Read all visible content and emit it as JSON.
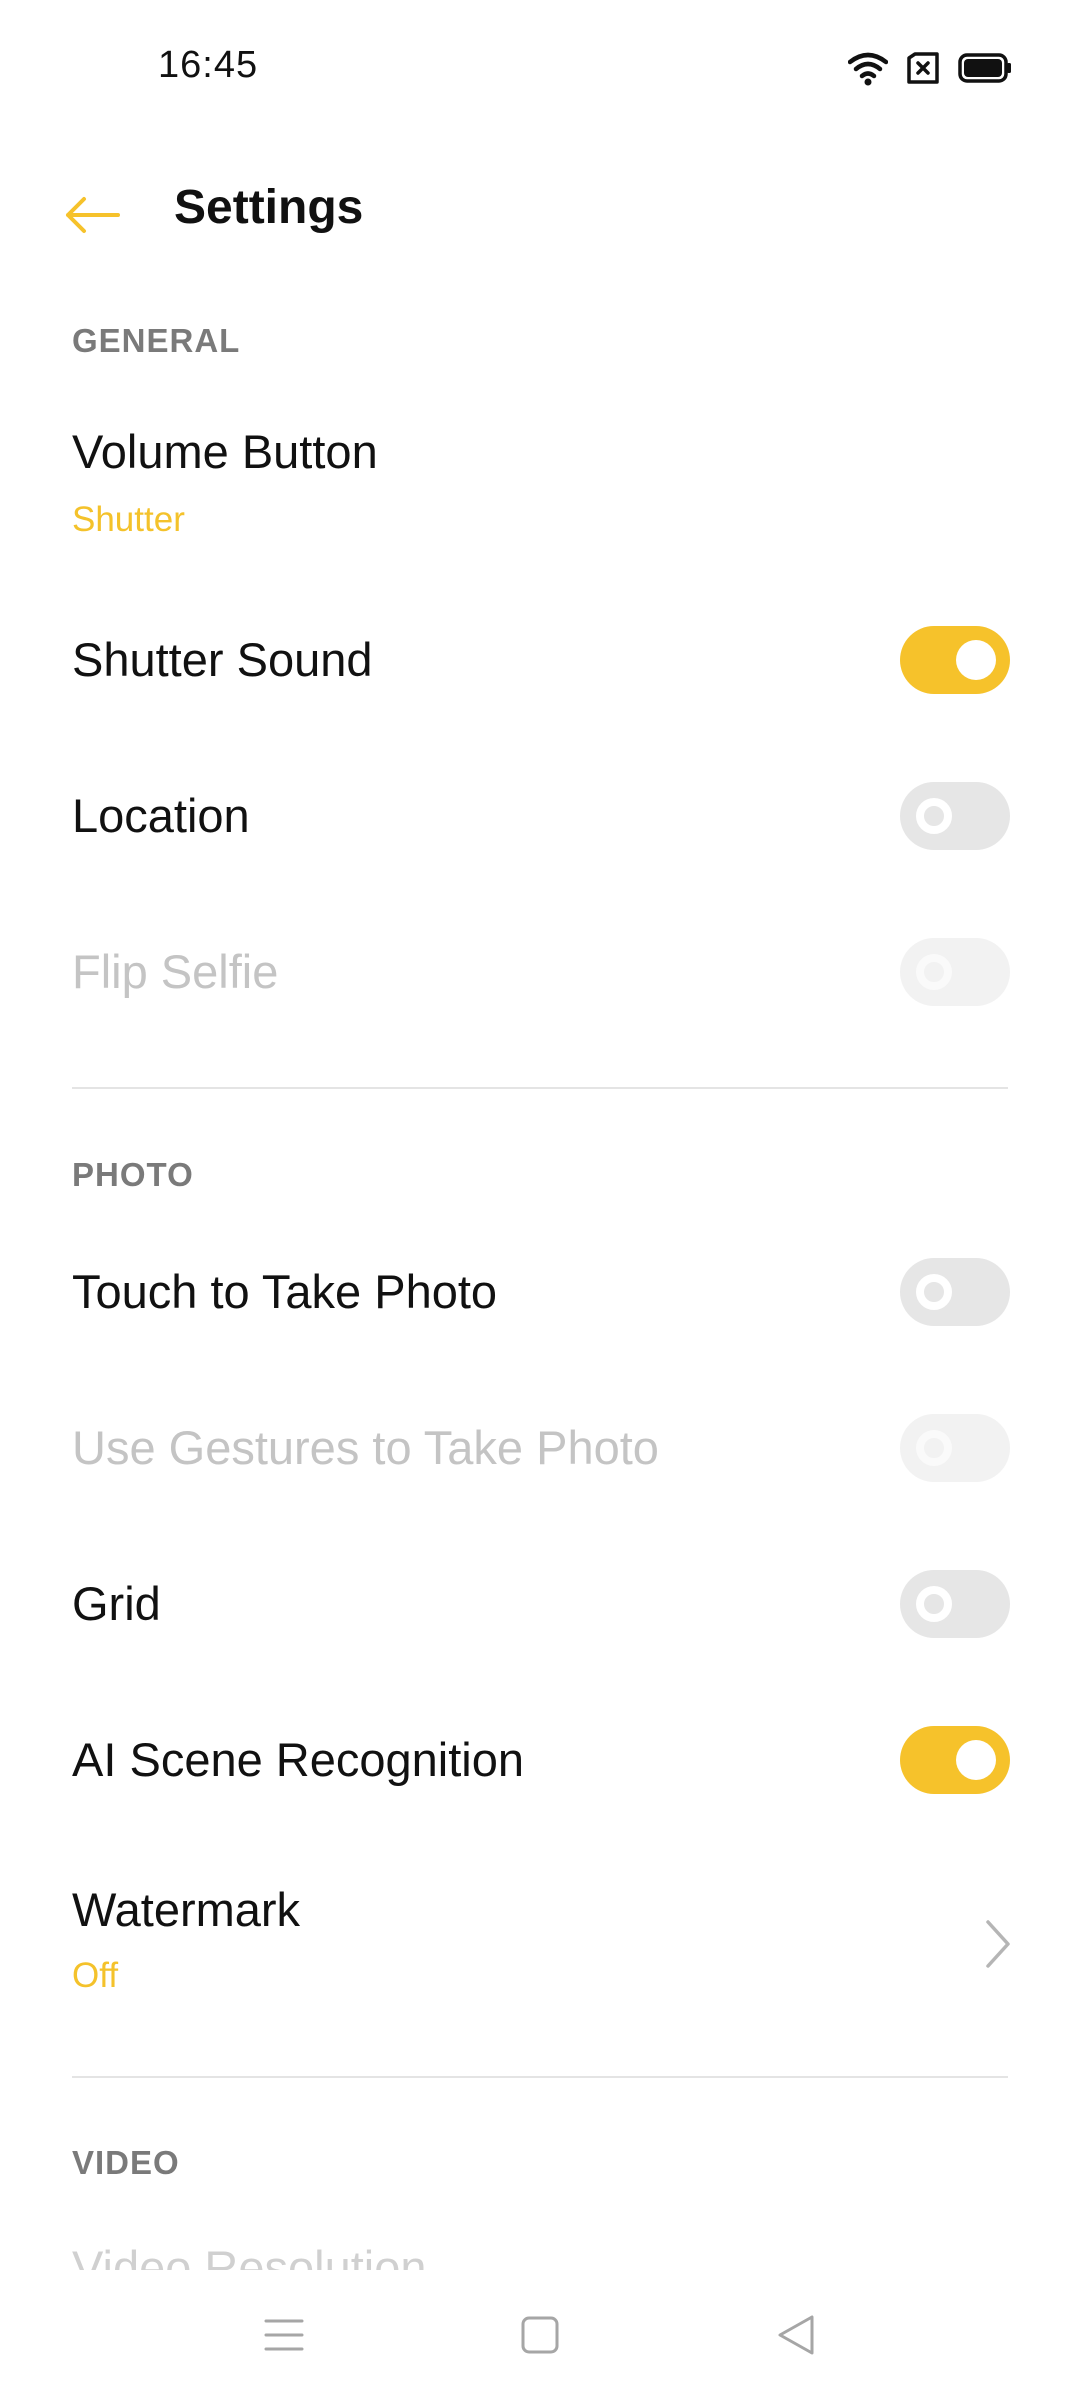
{
  "status_bar": {
    "time": "16:45",
    "icons": [
      "wifi-icon",
      "no-sim-icon",
      "battery-icon"
    ]
  },
  "header": {
    "title": "Settings",
    "back_icon": "arrow-left-icon"
  },
  "colors": {
    "accent": "#f6c22b",
    "toggle_off": "#e6e6e6",
    "section_header": "#7a7a7a",
    "disabled_text": "#c4c4c4"
  },
  "sections": {
    "general": {
      "header": "GENERAL",
      "items": [
        {
          "title": "Volume Button",
          "value": "Shutter"
        },
        {
          "title": "Shutter Sound",
          "toggle": "on"
        },
        {
          "title": "Location",
          "toggle": "off"
        },
        {
          "title": "Flip Selfie",
          "toggle": "off",
          "disabled": true
        }
      ]
    },
    "photo": {
      "header": "PHOTO",
      "items": [
        {
          "title": "Touch to Take Photo",
          "toggle": "off"
        },
        {
          "title": "Use Gestures to Take Photo",
          "toggle": "off",
          "disabled": true
        },
        {
          "title": "Grid",
          "toggle": "off"
        },
        {
          "title": "AI Scene Recognition",
          "toggle": "on"
        },
        {
          "title": "Watermark",
          "value": "Off"
        }
      ]
    },
    "video": {
      "header": "VIDEO",
      "items": [
        {
          "title": "Video Resolution"
        }
      ]
    }
  },
  "nav_bar": {
    "icons": [
      "menu-icon",
      "home-icon",
      "back-triangle-icon"
    ]
  }
}
